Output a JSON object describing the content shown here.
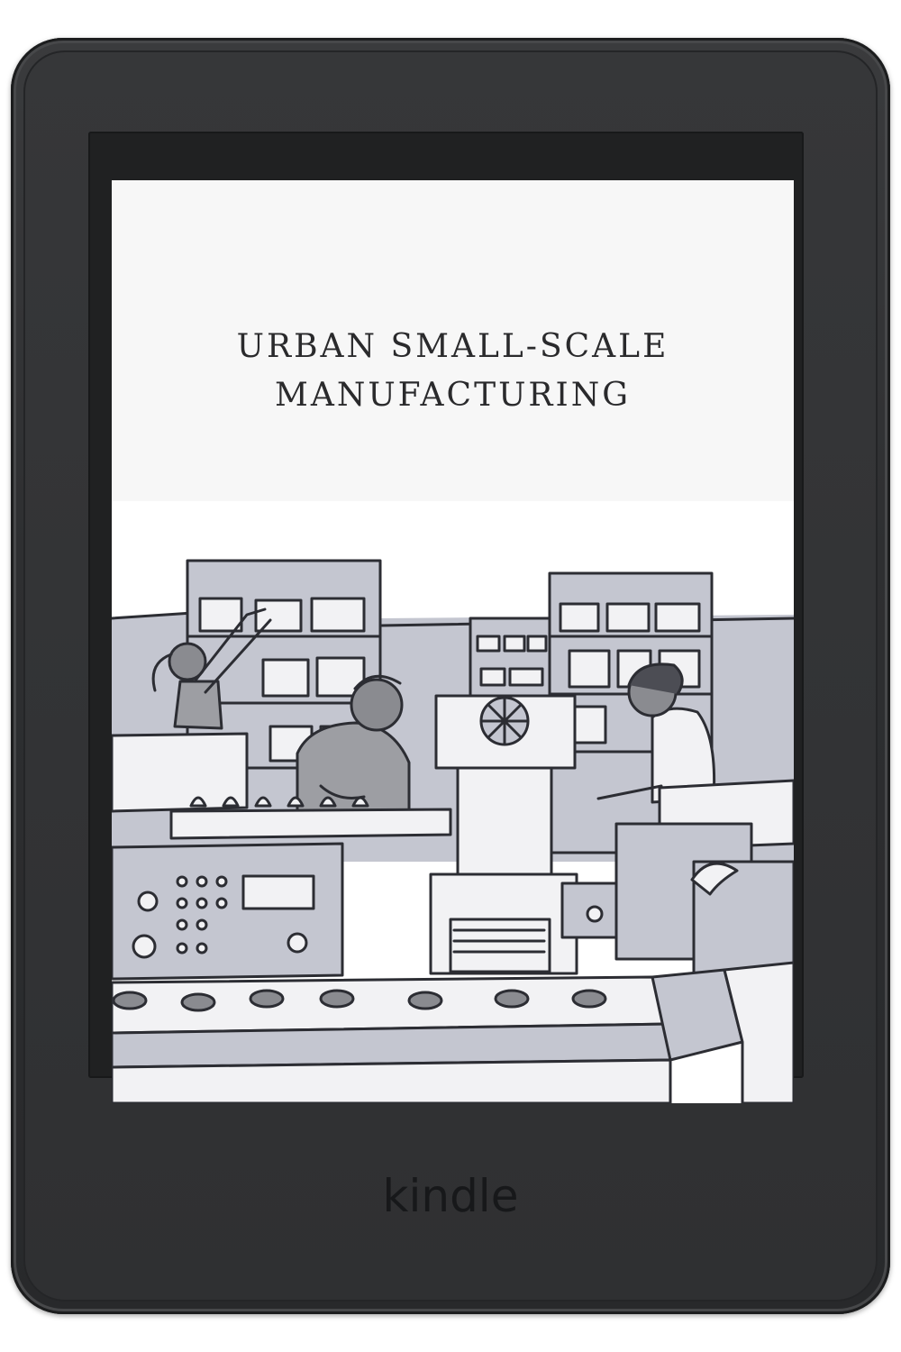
{
  "book": {
    "title_line1": "URBAN SMALL-SCALE",
    "title_line2": "MANUFACTURING"
  },
  "device": {
    "brand": "kindle"
  },
  "colors": {
    "bezel": "#2f3032",
    "screen": "#f7f7f7",
    "illustration_fill": "#c4c6d0",
    "ink": "#2a2a2c"
  }
}
